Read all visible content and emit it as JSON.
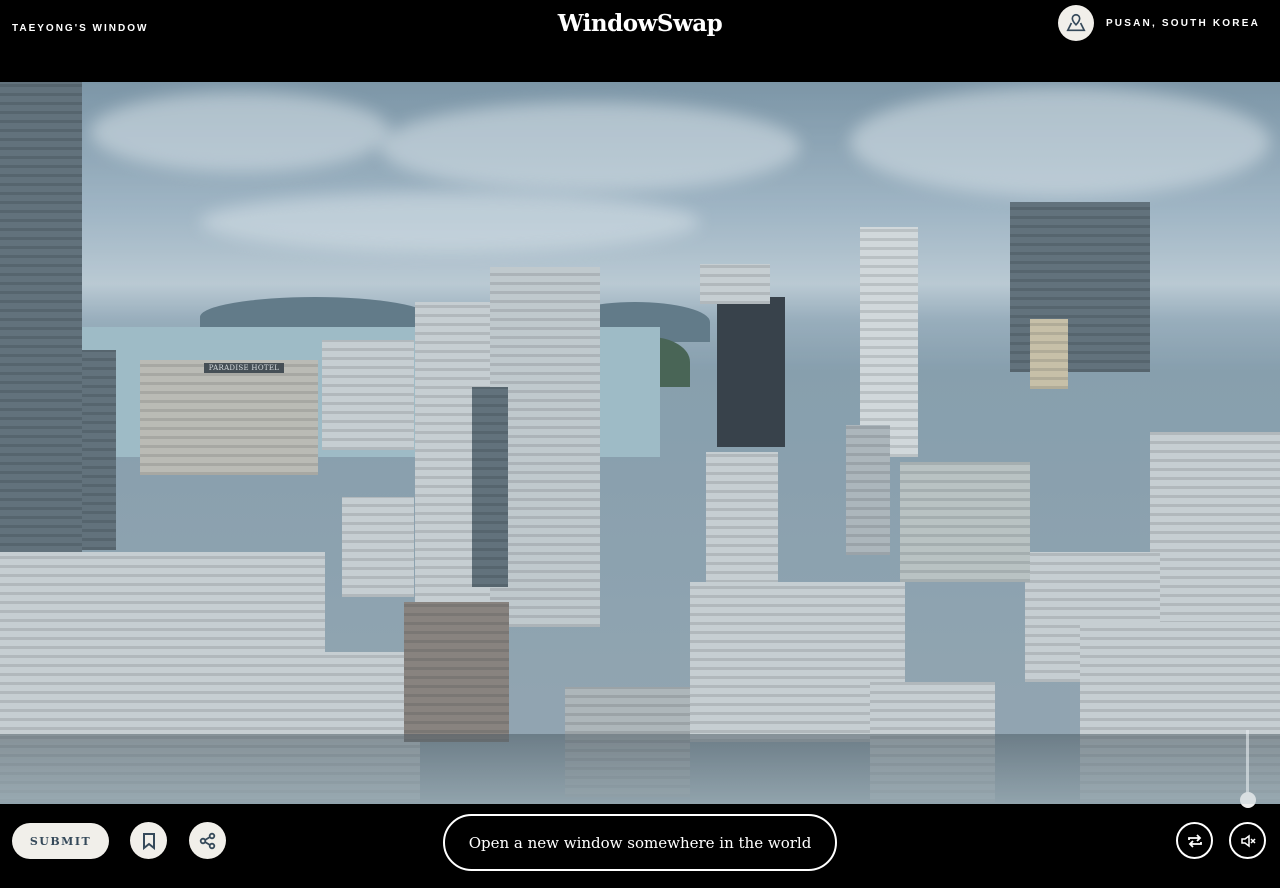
{
  "header": {
    "window_name": "Taeyong's Window",
    "logo": "WindowSwap",
    "location": "Pusan, South Korea",
    "location_icon": "map-pin-icon"
  },
  "view": {
    "description_alt": "",
    "hotel_sign": "PARADISE HOTEL",
    "volume_percent": 0
  },
  "footer": {
    "submit_label": "Submit",
    "bookmark_icon": "bookmark-icon",
    "share_icon": "share-icon",
    "cta_label": "Open a new window somewhere in the world",
    "shuffle_icon": "shuffle-icon",
    "mute_icon": "volume-mute-icon"
  },
  "colors": {
    "background": "#000000",
    "button_bg": "#f1efea",
    "button_text": "#35495a"
  }
}
